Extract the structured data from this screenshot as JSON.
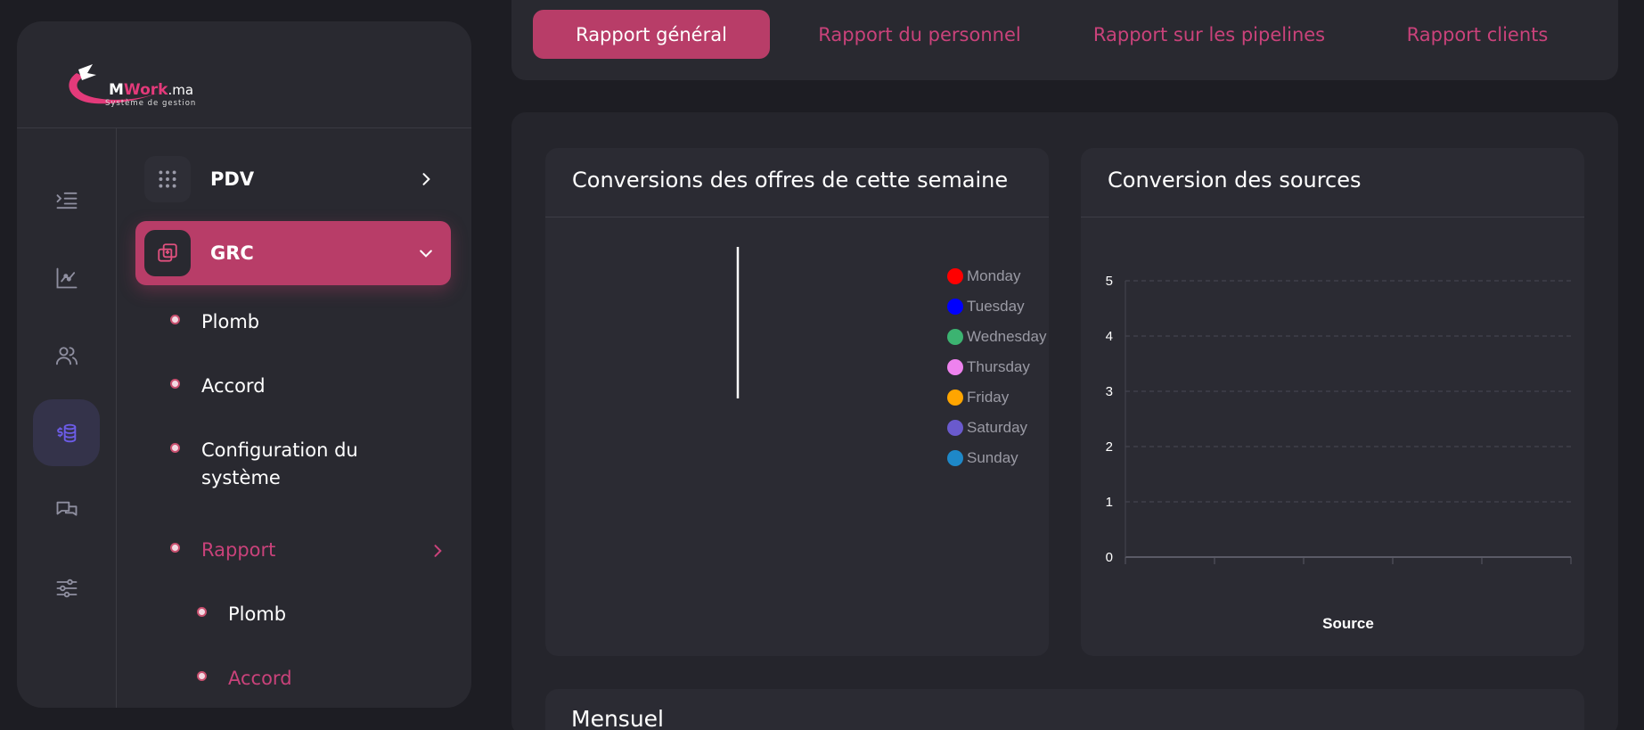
{
  "brand": {
    "name_prefix": "M",
    "name_work": "Work",
    "name_suffix": ".ma",
    "tagline": "Système de gestion",
    "accent": "#b83d68"
  },
  "rail": {
    "icons": [
      "menu-collapse-icon",
      "chart-icon",
      "users-icon",
      "database-icon",
      "chat-icon",
      "sliders-icon"
    ],
    "active_index": 3
  },
  "menu": {
    "pdv": {
      "label": "PDV",
      "icon": "grid-dots-icon"
    },
    "grc": {
      "label": "GRC",
      "icon": "layers-icon"
    },
    "subitems": [
      {
        "label": "Plomb"
      },
      {
        "label": "Accord"
      },
      {
        "label": "Configuration du",
        "label2": "système"
      },
      {
        "label": "Rapport"
      }
    ],
    "rapport_children": [
      {
        "label": "Plomb"
      },
      {
        "label": "Accord"
      }
    ]
  },
  "tabs": [
    {
      "label": "Rapport général",
      "active": true
    },
    {
      "label": "Rapport du personnel",
      "active": false
    },
    {
      "label": "Rapport sur les pipelines",
      "active": false
    },
    {
      "label": "Rapport clients",
      "active": false
    }
  ],
  "cards": {
    "weekly": {
      "title": "Conversions des offres de cette semaine"
    },
    "sources": {
      "title": "Conversion des sources"
    },
    "monthly": {
      "title": "Mensuel"
    }
  },
  "chart_data": [
    {
      "type": "pie",
      "title": "Conversions des offres de cette semaine",
      "categories": [
        "Monday",
        "Tuesday",
        "Wednesday",
        "Thursday",
        "Friday",
        "Saturday",
        "Sunday"
      ],
      "values": [
        0,
        0,
        0,
        0,
        0,
        0,
        0
      ],
      "colors": [
        "#ff0000",
        "#0000ff",
        "#3cb371",
        "#ee82ee",
        "#ffa500",
        "#6a5acd",
        "#1e88c8"
      ],
      "legend": "right"
    },
    {
      "type": "bar",
      "title": "Conversion des sources",
      "xlabel": "Source",
      "ylabel": "",
      "categories": [],
      "values": [],
      "ylim": [
        0,
        5
      ],
      "yticks": [
        "0",
        "1",
        "2",
        "3",
        "4",
        "5"
      ],
      "grid": true
    }
  ]
}
